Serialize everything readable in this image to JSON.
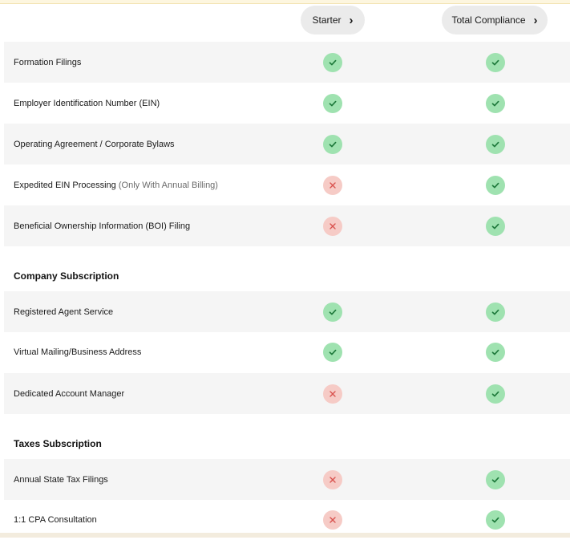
{
  "plans": [
    {
      "label": "Starter"
    },
    {
      "label": "Total Compliance"
    }
  ],
  "sections": [
    {
      "title": "",
      "rows": [
        {
          "label": "Formation Filings",
          "note": "",
          "starter": true,
          "total": true
        },
        {
          "label": "Employer Identification Number (EIN)",
          "note": "",
          "starter": true,
          "total": true
        },
        {
          "label": "Operating Agreement / Corporate Bylaws",
          "note": "",
          "starter": true,
          "total": true
        },
        {
          "label": "Expedited EIN Processing ",
          "note": "(Only With Annual Billing)",
          "starter": false,
          "total": true
        },
        {
          "label": "Beneficial Ownership Information (BOI) Filing",
          "note": "",
          "starter": false,
          "total": true
        }
      ]
    },
    {
      "title": "Company Subscription",
      "rows": [
        {
          "label": "Registered Agent Service",
          "note": "",
          "starter": true,
          "total": true
        },
        {
          "label": "Virtual Mailing/Business Address",
          "note": "",
          "starter": true,
          "total": true
        },
        {
          "label": "Dedicated Account Manager",
          "note": "",
          "starter": false,
          "total": true
        }
      ]
    },
    {
      "title": "Taxes Subscription",
      "rows": [
        {
          "label": "Annual State Tax Filings",
          "note": "",
          "starter": false,
          "total": true
        },
        {
          "label": "1:1 CPA Consultation",
          "note": "",
          "starter": false,
          "total": true
        }
      ]
    }
  ],
  "colors": {
    "check_bg": "#9fe2b0",
    "check_fg": "#1f7a3c",
    "cross_bg": "#f6cbc6",
    "cross_fg": "#d9534f",
    "row_shade": "#f5f5f5"
  },
  "icons": {
    "included": "check-icon",
    "excluded": "cross-icon",
    "chevron": "chevron-right-icon"
  }
}
